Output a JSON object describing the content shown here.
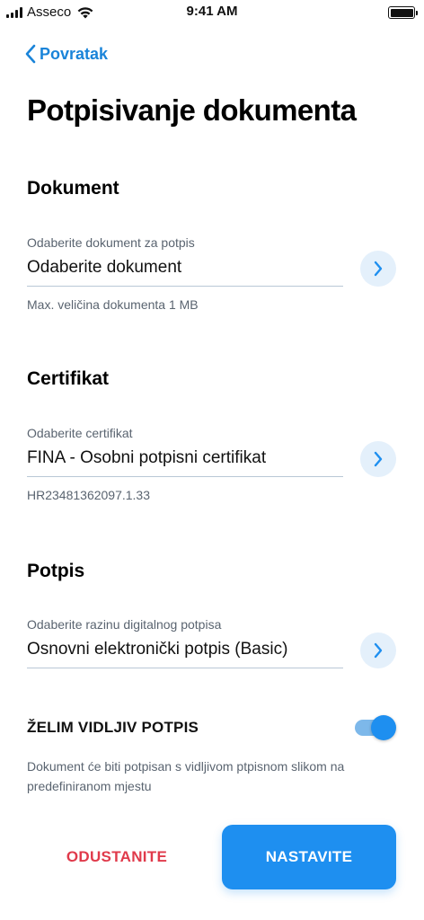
{
  "status_bar": {
    "carrier": "Asseco",
    "time": "9:41 AM"
  },
  "nav": {
    "back_label": "Povratak"
  },
  "page_title": "Potpisivanje dokumenta",
  "sections": {
    "document": {
      "title": "Dokument",
      "field_label": "Odaberite dokument za potpis",
      "field_value": "Odaberite dokument",
      "hint": "Max. veličina dokumenta 1 MB"
    },
    "certificate": {
      "title": "Certifikat",
      "field_label": "Odaberite certifikat",
      "field_value": "FINA - Osobni potpisni certifikat",
      "hint": "HR23481362097.1.33"
    },
    "signature": {
      "title": "Potpis",
      "field_label": "Odaberite razinu digitalnog potpisa",
      "field_value": "Osnovni elektronički potpis (Basic)"
    }
  },
  "visible_signature": {
    "label": "ŽELIM VIDLJIV POTPIS",
    "enabled": true,
    "description": "Dokument će biti potpisan s vidljivom ptpisnom slikom na predefiniranom mjestu"
  },
  "actions": {
    "cancel_label": "ODUSTANITE",
    "continue_label": "NASTAVITE"
  },
  "colors": {
    "accent": "#1e8ff0",
    "link": "#1a84d9",
    "danger": "#e03a4b",
    "muted_text": "#5a6470"
  },
  "icons": [
    "signal-icon",
    "wifi-icon",
    "battery-icon",
    "chevron-left-icon",
    "chevron-right-icon"
  ]
}
